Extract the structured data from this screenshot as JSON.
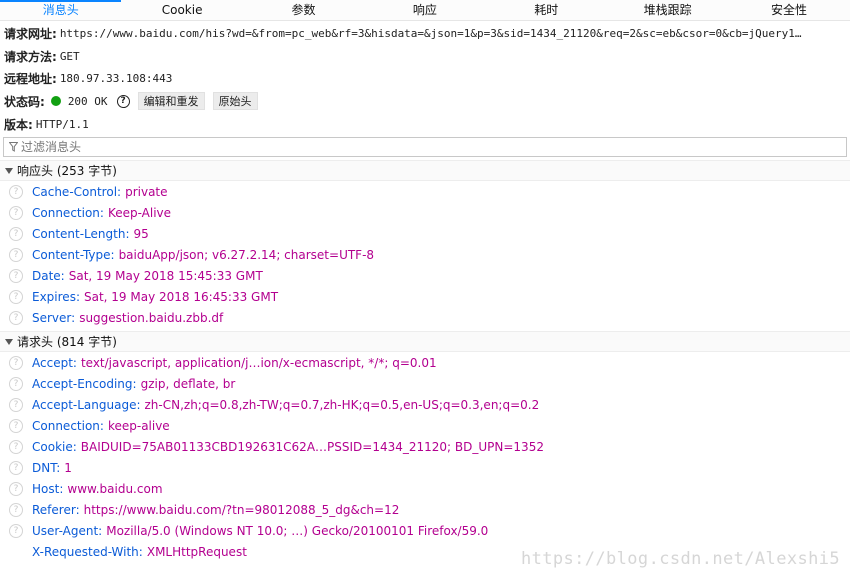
{
  "tabs": [
    {
      "label": "消息头",
      "active": true
    },
    {
      "label": "Cookie"
    },
    {
      "label": "参数"
    },
    {
      "label": "响应"
    },
    {
      "label": "耗时"
    },
    {
      "label": "堆栈跟踪"
    },
    {
      "label": "安全性"
    }
  ],
  "summary": {
    "url_label": "请求网址:",
    "url_value": "https://www.baidu.com/his?wd=&from=pc_web&rf=3&hisdata=&json=1&p=3&sid=1434_21120&req=2&sc=eb&csor=0&cb=jQuery1…",
    "method_label": "请求方法:",
    "method_value": "GET",
    "remote_label": "远程地址:",
    "remote_value": "180.97.33.108:443",
    "status_label": "状态码:",
    "status_value": "200 OK",
    "help_glyph": "?",
    "edit_resend_label": "编辑和重发",
    "raw_headers_label": "原始头",
    "version_label": "版本:",
    "version_value": "HTTP/1.1"
  },
  "filter": {
    "placeholder": "过滤消息头"
  },
  "response_headers": {
    "title": "响应头 (253 字节)",
    "rows": [
      {
        "name": "Cache-Control:",
        "value": "private"
      },
      {
        "name": "Connection:",
        "value": "Keep-Alive"
      },
      {
        "name": "Content-Length:",
        "value": "95"
      },
      {
        "name": "Content-Type:",
        "value": "baiduApp/json; v6.27.2.14; charset=UTF-8"
      },
      {
        "name": "Date:",
        "value": "Sat, 19 May 2018 15:45:33 GMT"
      },
      {
        "name": "Expires:",
        "value": "Sat, 19 May 2018 16:45:33 GMT"
      },
      {
        "name": "Server:",
        "value": "suggestion.baidu.zbb.df"
      }
    ]
  },
  "request_headers": {
    "title": "请求头 (814 字节)",
    "rows": [
      {
        "name": "Accept:",
        "value": "text/javascript, application/j…ion/x-ecmascript, */*; q=0.01"
      },
      {
        "name": "Accept-Encoding:",
        "value": "gzip, deflate, br"
      },
      {
        "name": "Accept-Language:",
        "value": "zh-CN,zh;q=0.8,zh-TW;q=0.7,zh-HK;q=0.5,en-US;q=0.3,en;q=0.2"
      },
      {
        "name": "Connection:",
        "value": "keep-alive"
      },
      {
        "name": "Cookie:",
        "value": "BAIDUID=75AB01133CBD192631C62A…PSSID=1434_21120; BD_UPN=1352"
      },
      {
        "name": "DNT:",
        "value": "1"
      },
      {
        "name": "Host:",
        "value": "www.baidu.com"
      },
      {
        "name": "Referer:",
        "value": "https://www.baidu.com/?tn=98012088_5_dg&ch=12"
      },
      {
        "name": "User-Agent:",
        "value": "Mozilla/5.0 (Windows NT 10.0; …) Gecko/20100101 Firefox/59.0"
      },
      {
        "name": "X-Requested-With:",
        "value": "XMLHttpRequest",
        "no_help_icon": true
      }
    ]
  },
  "watermark": "https://blog.csdn.net/Alexshi5",
  "colors": {
    "accent": "#0a84ff",
    "header_name": "#0b5bd7",
    "header_value": "#b3008f",
    "status_ok": "#12a012"
  }
}
